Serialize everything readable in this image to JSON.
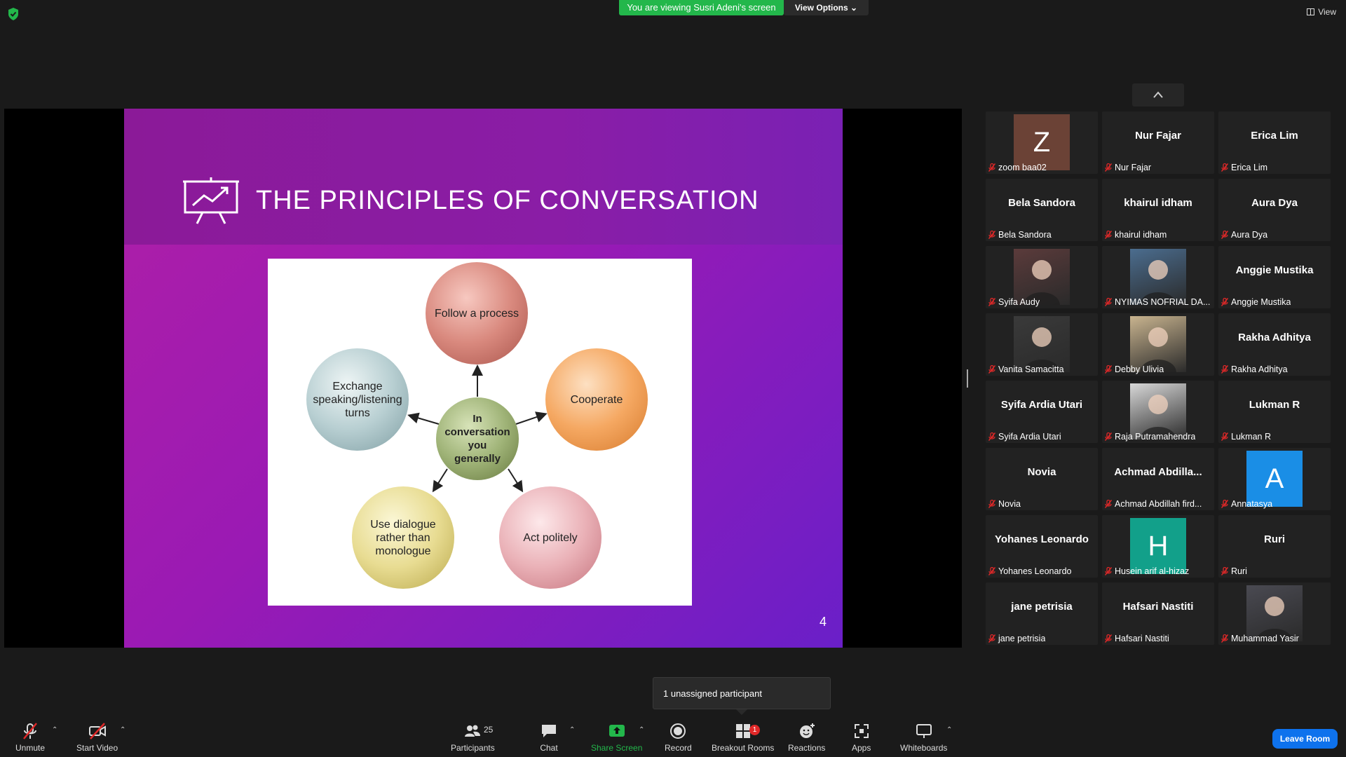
{
  "top": {
    "viewing_banner": "You are viewing Susri Adeni's screen",
    "view_options": "View Options",
    "view": "View"
  },
  "slide": {
    "title": "THE PRINCIPLES OF CONVERSATION",
    "page_number": "4",
    "diagram": {
      "center": "In conversation you generally",
      "follow": "Follow a process",
      "cooperate": "Cooperate",
      "act": "Act politely",
      "dialogue": "Use dialogue rather than monologue",
      "exchange": "Exchange speaking/listening turns"
    }
  },
  "gallery": {
    "tiles": [
      {
        "name": "",
        "label": "zoom baa02",
        "avatar": "Z",
        "avatar_color": "#6b4236"
      },
      {
        "name": "Nur Fajar",
        "label": "Nur Fajar"
      },
      {
        "name": "Erica Lim",
        "label": "Erica Lim"
      },
      {
        "name": "Bela Sandora",
        "label": "Bela Sandora"
      },
      {
        "name": "khairul idham",
        "label": "khairul idham"
      },
      {
        "name": "Aura Dya",
        "label": "Aura Dya"
      },
      {
        "name": "",
        "label": "Syifa Audy",
        "photo": true
      },
      {
        "name": "",
        "label": "NYIMAS NOFRIAL DA...",
        "photo": true
      },
      {
        "name": "Anggie Mustika",
        "label": "Anggie Mustika"
      },
      {
        "name": "",
        "label": "Vanita Samacitta",
        "photo": true
      },
      {
        "name": "",
        "label": "Debby Ulivia",
        "photo": true
      },
      {
        "name": "Rakha Adhitya",
        "label": "Rakha Adhitya"
      },
      {
        "name": "Syifa Ardia Utari",
        "label": "Syifa Ardia Utari"
      },
      {
        "name": "",
        "label": "Raja Putramahendra",
        "photo": true
      },
      {
        "name": "Lukman R",
        "label": "Lukman R"
      },
      {
        "name": "Novia",
        "label": "Novia"
      },
      {
        "name": "Achmad  Abdilla...",
        "label": "Achmad Abdillah fird..."
      },
      {
        "name": "",
        "label": "Annatasya",
        "avatar": "A",
        "avatar_color": "#1a8ee6"
      },
      {
        "name": "Yohanes Leonardo",
        "label": "Yohanes Leonardo"
      },
      {
        "name": "",
        "label": "Husein arif al-hizaz",
        "avatar": "H",
        "avatar_color": "#12a08a"
      },
      {
        "name": "Ruri",
        "label": "Ruri"
      },
      {
        "name": "jane petrisia",
        "label": "jane petrisia"
      },
      {
        "name": "Hafsari Nastiti",
        "label": "Hafsari Nastiti"
      },
      {
        "name": "",
        "label": "Muhammad Yasir",
        "photo": true
      }
    ]
  },
  "popup": "1 unassigned participant",
  "toolbar": {
    "unmute": "Unmute",
    "start_video": "Start Video",
    "participants": "Participants",
    "participants_count": "25",
    "chat": "Chat",
    "share_screen": "Share Screen",
    "record": "Record",
    "breakout_rooms": "Breakout Rooms",
    "breakout_badge": "1",
    "reactions": "Reactions",
    "apps": "Apps",
    "whiteboards": "Whiteboards",
    "leave_room": "Leave Room"
  },
  "colors": {
    "share_green": "#23b74b",
    "leave_blue": "#0e72ed",
    "mic_off_red": "#e02828"
  }
}
